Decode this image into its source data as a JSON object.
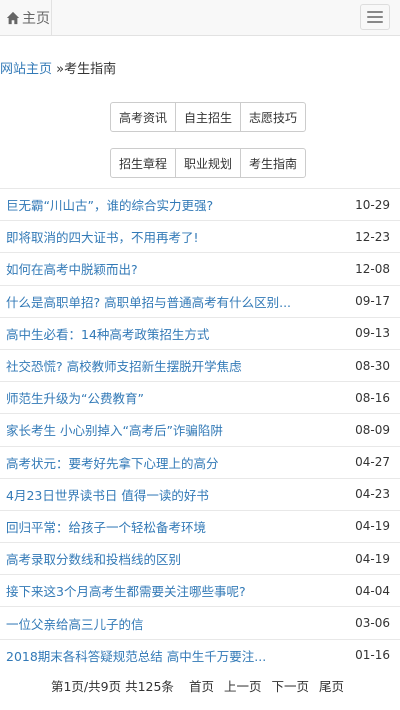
{
  "nav": {
    "home_label": "主页"
  },
  "breadcrumb": {
    "site_home": "网站主页",
    "separator": " »",
    "current": "考生指南"
  },
  "categories_row1": [
    "高考资讯",
    "自主招生",
    "志愿技巧"
  ],
  "categories_row2": [
    "招生章程",
    "职业规划",
    "考生指南"
  ],
  "articles": [
    {
      "title": "巨无霸“川山古”，谁的综合实力更强?",
      "date": "10-29"
    },
    {
      "title": "即将取消的四大证书，不用再考了!",
      "date": "12-23"
    },
    {
      "title": "如何在高考中脱颖而出?",
      "date": "12-08"
    },
    {
      "title": "什么是高职单招? 高职单招与普通高考有什么区别...",
      "date": "09-17"
    },
    {
      "title": "高中生必看：14种高考政策招生方式",
      "date": "09-13"
    },
    {
      "title": "社交恐慌? 高校教师支招新生摆脱开学焦虑",
      "date": "08-30"
    },
    {
      "title": "师范生升级为“公费教育”",
      "date": "08-16"
    },
    {
      "title": "家长考生 小心别掉入“高考后”诈骗陷阱",
      "date": "08-09"
    },
    {
      "title": "高考状元：要考好先拿下心理上的高分",
      "date": "04-27"
    },
    {
      "title": "4月23日世界读书日 值得一读的好书",
      "date": "04-23"
    },
    {
      "title": "回归平常：给孩子一个轻松备考环境",
      "date": "04-19"
    },
    {
      "title": "高考录取分数线和投档线的区别",
      "date": "04-19"
    },
    {
      "title": "接下来这3个月高考生都需要关注哪些事呢?",
      "date": "04-04"
    },
    {
      "title": "一位父亲给高三儿子的信",
      "date": "03-06"
    },
    {
      "title": "2018期末各科答疑规范总结 高中生千万要注...",
      "date": "01-16"
    }
  ],
  "pager": {
    "info": "第1页/共9页 共125条",
    "first": "首页",
    "prev": "上一页",
    "next": "下一页",
    "last": "尾页"
  }
}
